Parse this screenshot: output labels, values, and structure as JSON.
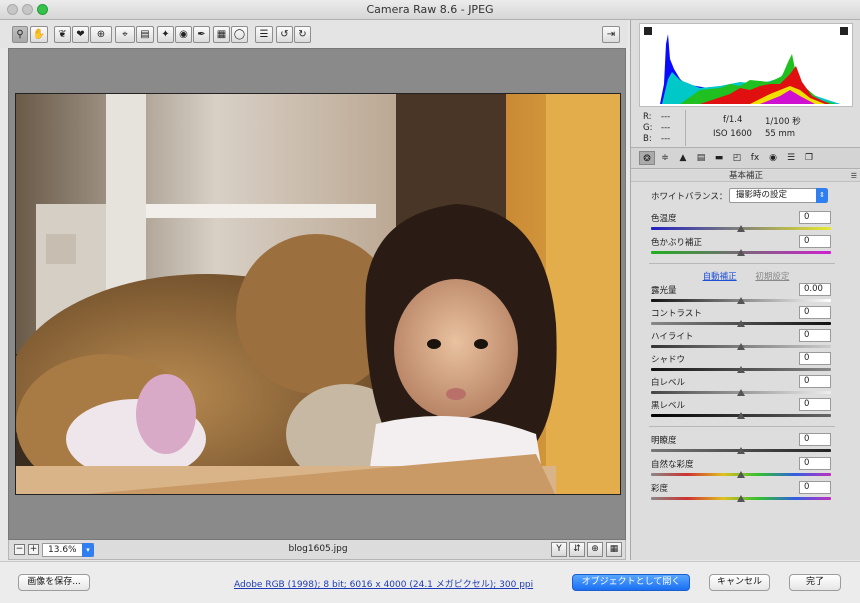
{
  "window": {
    "title": "Camera Raw 8.6  -  JPEG"
  },
  "toolbar": {
    "tools": [
      "zoom-icon",
      "hand-icon",
      "white-balance-icon",
      "color-sampler-icon",
      "targeted-adjustment-icon",
      "crop-icon",
      "straighten-icon",
      "spot-removal-icon",
      "red-eye-icon",
      "adjustment-brush-icon",
      "graduated-filter-icon",
      "radial-filter-icon",
      "preferences-icon",
      "rotate-ccw-icon",
      "rotate-cw-icon"
    ],
    "fullscreen_icon": "fullscreen-icon"
  },
  "preview": {
    "filename": "blog1605.jpg",
    "zoom": "13.6%",
    "zoom_out": "−",
    "zoom_in": "+"
  },
  "histogram": {
    "r_label": "R:",
    "g_label": "G:",
    "b_label": "B:",
    "r_value": "---",
    "g_value": "---",
    "b_value": "---",
    "aperture": "f/1.4",
    "shutter": "1/100 秒",
    "iso": "ISO 1600",
    "focal": "55 mm"
  },
  "panel": {
    "title": "基本補正",
    "wb_label": "ホワイトバランス：",
    "wb_value": "撮影時の設定",
    "auto": "自動補正",
    "default": "初期設定",
    "sliders": [
      {
        "label": "色温度",
        "value": "0"
      },
      {
        "label": "色かぶり補正",
        "value": "0"
      },
      {
        "label": "露光量",
        "value": "0.00"
      },
      {
        "label": "コントラスト",
        "value": "0"
      },
      {
        "label": "ハイライト",
        "value": "0"
      },
      {
        "label": "シャドウ",
        "value": "0"
      },
      {
        "label": "白レベル",
        "value": "0"
      },
      {
        "label": "黒レベル",
        "value": "0"
      },
      {
        "label": "明瞭度",
        "value": "0"
      },
      {
        "label": "自然な彩度",
        "value": "0"
      },
      {
        "label": "彩度",
        "value": "0"
      }
    ]
  },
  "footer": {
    "save": "画像を保存...",
    "workflow": "Adobe RGB (1998); 8 bit; 6016 x 4000 (24.1 メガピクセル); 300 ppi",
    "open_object": "オブジェクトとして開く",
    "cancel": "キャンセル",
    "done": "完了"
  },
  "colors": {
    "accent": "#2f7ff0",
    "link": "#1d4fd8"
  }
}
